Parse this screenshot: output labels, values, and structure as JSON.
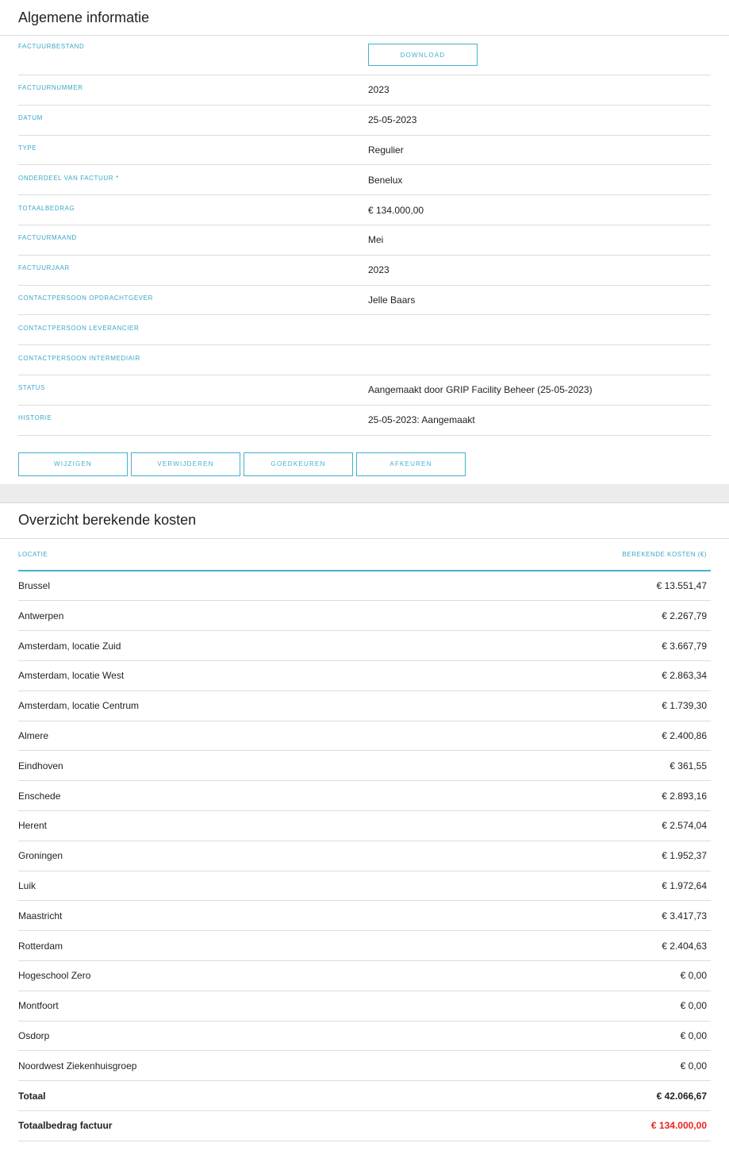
{
  "general": {
    "title": "Algemene informatie",
    "rows": [
      {
        "label": "Factuurbestand",
        "value": ""
      },
      {
        "label": "Factuurnummer",
        "value": "2023"
      },
      {
        "label": "Datum",
        "value": "25-05-2023"
      },
      {
        "label": "Type",
        "value": "Regulier"
      },
      {
        "label": "Onderdeel van factuur *",
        "value": "Benelux"
      },
      {
        "label": "Totaalbedrag",
        "value": "€ 134.000,00"
      },
      {
        "label": "Factuurmaand",
        "value": "Mei"
      },
      {
        "label": "Factuurjaar",
        "value": "2023"
      },
      {
        "label": "Contactpersoon opdrachtgever",
        "value": "Jelle Baars"
      },
      {
        "label": "Contactpersoon leverancier",
        "value": ""
      },
      {
        "label": "Contactpersoon intermediair",
        "value": ""
      },
      {
        "label": "Status",
        "value": "Aangemaakt door GRIP Facility Beheer (25-05-2023)"
      },
      {
        "label": "Historie",
        "value": "25-05-2023: Aangemaakt"
      }
    ],
    "download_label": "Download",
    "actions": {
      "edit": "Wijzigen",
      "delete": "Verwijderen",
      "approve": "Goedkeuren",
      "reject": "Afkeuren"
    }
  },
  "costs": {
    "title": "Overzicht berekende kosten",
    "columns": {
      "location": "Locatie",
      "cost": "Berekende kosten (€)"
    },
    "rows": [
      {
        "location": "Brussel",
        "cost": "€ 13.551,47"
      },
      {
        "location": "Antwerpen",
        "cost": "€ 2.267,79"
      },
      {
        "location": "Amsterdam, locatie Zuid",
        "cost": "€ 3.667,79"
      },
      {
        "location": "Amsterdam, locatie West",
        "cost": "€ 2.863,34"
      },
      {
        "location": "Amsterdam, locatie Centrum",
        "cost": "€ 1.739,30"
      },
      {
        "location": "Almere",
        "cost": "€ 2.400,86"
      },
      {
        "location": "Eindhoven",
        "cost": "€ 361,55"
      },
      {
        "location": "Enschede",
        "cost": "€ 2.893,16"
      },
      {
        "location": "Herent",
        "cost": "€ 2.574,04"
      },
      {
        "location": "Groningen",
        "cost": "€ 1.952,37"
      },
      {
        "location": "Luik",
        "cost": "€ 1.972,64"
      },
      {
        "location": "Maastricht",
        "cost": "€ 3.417,73"
      },
      {
        "location": "Rotterdam",
        "cost": "€ 2.404,63"
      },
      {
        "location": "Hogeschool Zero",
        "cost": "€ 0,00"
      },
      {
        "location": "Montfoort",
        "cost": "€ 0,00"
      },
      {
        "location": "Osdorp",
        "cost": "€ 0,00"
      },
      {
        "location": "Noordwest Ziekenhuisgroep",
        "cost": "€ 0,00"
      }
    ],
    "total": {
      "label": "Totaal",
      "value": "€ 42.066,67"
    },
    "invoice_total": {
      "label": "Totaalbedrag factuur",
      "value": "€ 134.000,00",
      "color": "#ee2222"
    }
  }
}
